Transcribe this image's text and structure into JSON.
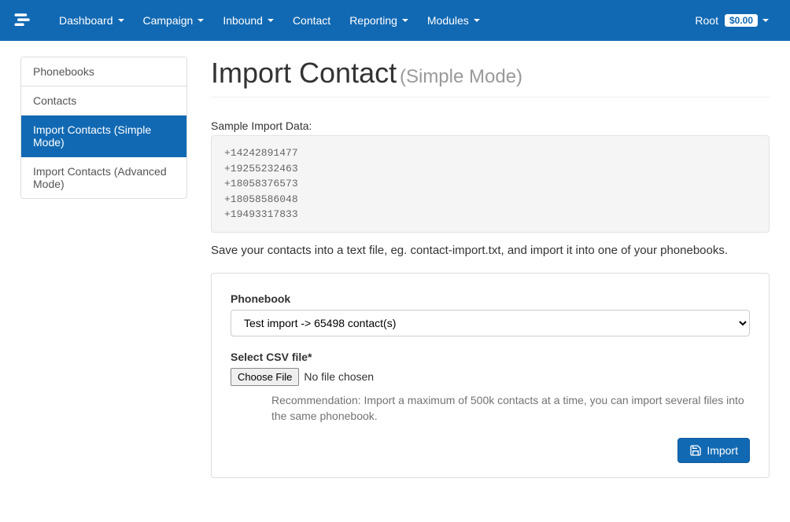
{
  "nav": {
    "items": [
      {
        "label": "Dashboard",
        "caret": true
      },
      {
        "label": "Campaign",
        "caret": true
      },
      {
        "label": "Inbound",
        "caret": true
      },
      {
        "label": "Contact",
        "caret": false
      },
      {
        "label": "Reporting",
        "caret": true
      },
      {
        "label": "Modules",
        "caret": true
      }
    ],
    "user": {
      "name": "Root",
      "balance": "$0.00"
    }
  },
  "sidebar": {
    "items": [
      {
        "label": "Phonebooks",
        "active": false
      },
      {
        "label": "Contacts",
        "active": false
      },
      {
        "label": "Import Contacts (Simple Mode)",
        "active": true
      },
      {
        "label": "Import Contacts (Advanced Mode)",
        "active": false
      }
    ]
  },
  "page": {
    "title": "Import Contact",
    "subtitle": "(Simple Mode)",
    "sample_label": "Sample Import Data:",
    "sample_data": "+14242891477\n+19255232463\n+18058376573\n+18058586048\n+19493317833",
    "save_hint": "Save your contacts into a text file, eg. contact-import.txt, and import it into one of your phonebooks."
  },
  "form": {
    "phonebook_label": "Phonebook",
    "phonebook_value": "Test import -> 65498 contact(s)",
    "csv_label": "Select CSV file*",
    "choose_file_label": "Choose File",
    "no_file_text": "No file chosen",
    "recommendation": "Recommendation: Import a maximum of 500k contacts at a time, you can import several files into the same phonebook.",
    "import_button": "Import"
  }
}
